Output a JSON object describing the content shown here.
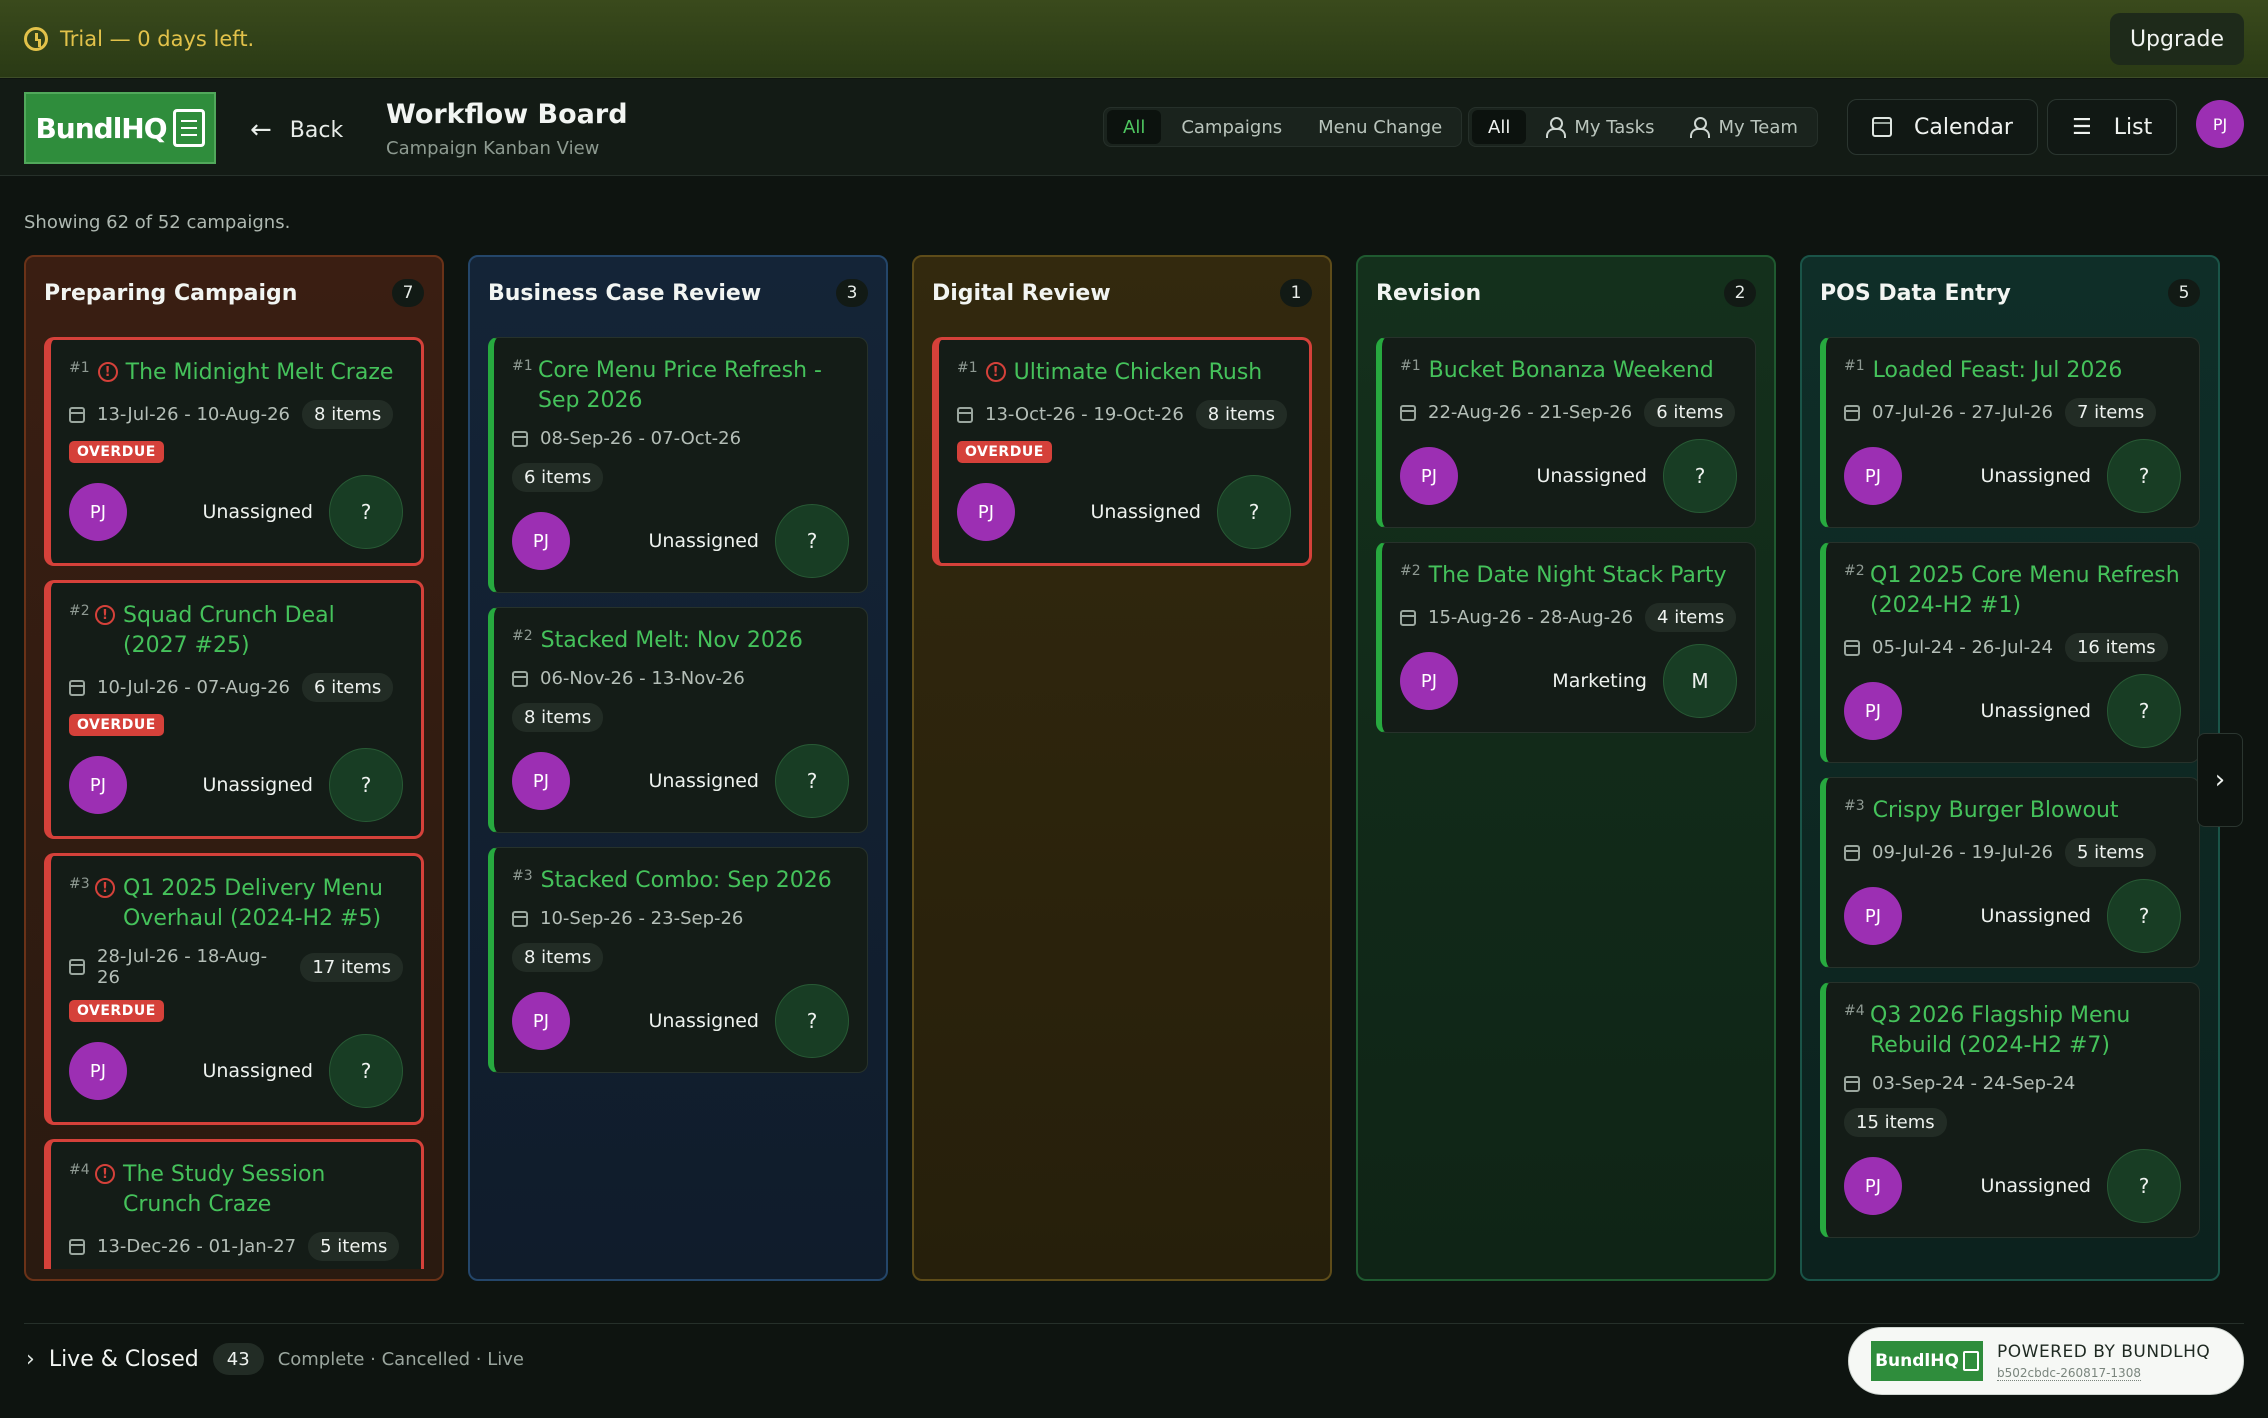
{
  "trial": {
    "text": "Trial — 0 days left.",
    "upgrade": "Upgrade"
  },
  "header": {
    "logo_text": "BundlHQ",
    "back": "Back",
    "title": "Workflow Board",
    "subtitle": "Campaign Kanban View",
    "type_filter": [
      "All",
      "Campaigns",
      "Menu Change"
    ],
    "scope_filter": [
      "All",
      "My Tasks",
      "My Team"
    ],
    "calendar": "Calendar",
    "list": "List",
    "user_initials": "PJ"
  },
  "showing": "Showing 62 of 52 campaigns.",
  "overdue_label": "OVERDUE",
  "columns": [
    {
      "name": "Preparing Campaign",
      "count": "7"
    },
    {
      "name": "Business Case Review",
      "count": "3"
    },
    {
      "name": "Digital Review",
      "count": "1"
    },
    {
      "name": "Revision",
      "count": "2"
    },
    {
      "name": "POS Data Entry",
      "count": "5"
    }
  ],
  "cards": {
    "c0": [
      {
        "num": "#1",
        "name": "The Midnight Melt Craze",
        "dates": "13-Jul-26 - 10-Aug-26",
        "items": "8 items",
        "avatar": "PJ",
        "assignee": "Unassigned",
        "assignee_initial": "?"
      },
      {
        "num": "#2",
        "name": "Squad Crunch Deal (2027 #25)",
        "dates": "10-Jul-26 - 07-Aug-26",
        "items": "6 items",
        "avatar": "PJ",
        "assignee": "Unassigned",
        "assignee_initial": "?"
      },
      {
        "num": "#3",
        "name": "Q1 2025 Delivery Menu Overhaul (2024-H2 #5)",
        "dates": "28-Jul-26 - 18-Aug-26",
        "items": "17 items",
        "avatar": "PJ",
        "assignee": "Unassigned",
        "assignee_initial": "?"
      },
      {
        "num": "#4",
        "name": "The Study Session Crunch Craze",
        "dates": "13-Dec-26 - 01-Jan-27",
        "items": "5 items"
      }
    ],
    "c1": [
      {
        "num": "#1",
        "name": "Core Menu Price Refresh - Sep 2026",
        "dates": "08-Sep-26 - 07-Oct-26",
        "items": "6 items",
        "avatar": "PJ",
        "assignee": "Unassigned",
        "assignee_initial": "?"
      },
      {
        "num": "#2",
        "name": "Stacked Melt: Nov 2026",
        "dates": "06-Nov-26 - 13-Nov-26",
        "items": "8 items",
        "avatar": "PJ",
        "assignee": "Unassigned",
        "assignee_initial": "?"
      },
      {
        "num": "#3",
        "name": "Stacked Combo: Sep 2026",
        "dates": "10-Sep-26 - 23-Sep-26",
        "items": "8 items",
        "avatar": "PJ",
        "assignee": "Unassigned",
        "assignee_initial": "?"
      }
    ],
    "c2": [
      {
        "num": "#1",
        "name": "Ultimate Chicken Rush",
        "dates": "13-Oct-26 - 19-Oct-26",
        "items": "8 items",
        "avatar": "PJ",
        "assignee": "Unassigned",
        "assignee_initial": "?"
      }
    ],
    "c3": [
      {
        "num": "#1",
        "name": "Bucket Bonanza Weekend",
        "dates": "22-Aug-26 - 21-Sep-26",
        "items": "6 items",
        "avatar": "PJ",
        "assignee": "Unassigned",
        "assignee_initial": "?"
      },
      {
        "num": "#2",
        "name": "The Date Night Stack Party",
        "dates": "15-Aug-26 - 28-Aug-26",
        "items": "4 items",
        "avatar": "PJ",
        "assignee": "Marketing",
        "assignee_initial": "M"
      }
    ],
    "c4": [
      {
        "num": "#1",
        "name": "Loaded Feast: Jul 2026",
        "dates": "07-Jul-26 - 27-Jul-26",
        "items": "7 items",
        "avatar": "PJ",
        "assignee": "Unassigned",
        "assignee_initial": "?"
      },
      {
        "num": "#2",
        "name": "Q1 2025 Core Menu Refresh (2024-H2 #1)",
        "dates": "05-Jul-24 - 26-Jul-24",
        "items": "16 items",
        "avatar": "PJ",
        "assignee": "Unassigned",
        "assignee_initial": "?"
      },
      {
        "num": "#3",
        "name": "Crispy Burger Blowout",
        "dates": "09-Jul-26 - 19-Jul-26",
        "items": "5 items",
        "avatar": "PJ",
        "assignee": "Unassigned",
        "assignee_initial": "?"
      },
      {
        "num": "#4",
        "name": "Q3 2026 Flagship Menu Rebuild (2024-H2 #7)",
        "dates": "03-Sep-24 - 24-Sep-24",
        "items": "15 items",
        "avatar": "PJ",
        "assignee": "Unassigned",
        "assignee_initial": "?"
      }
    ]
  },
  "footer": {
    "live_label": "Live & Closed",
    "live_count": "43",
    "live_sub": "Complete · Cancelled · Live",
    "powered": "POWERED BY BUNDLHQ",
    "version": "b502cbdc-260817-1308",
    "powered_logo": "BundlHQ"
  },
  "colors": {
    "accent": "#45c25b",
    "overdue": "#d5413a",
    "avatar": "#9c2fb3"
  }
}
